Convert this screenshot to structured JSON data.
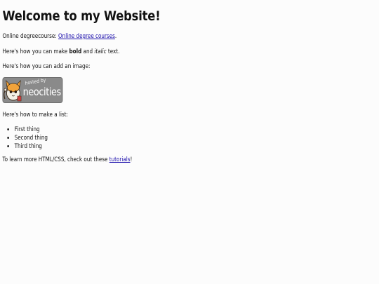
{
  "heading": "Welcome to my Website!",
  "line1": {
    "prefix": "Online degreecourse: ",
    "link_text": "Online degree courses",
    "suffix": "."
  },
  "line2": {
    "prefix": "Here's how you can make ",
    "bold": "bold",
    "middle": " and ",
    "italic": "italic",
    "suffix": " text."
  },
  "line3": "Here's how you can add an image:",
  "badge": {
    "small_text": "hosted by",
    "big_text": "neocities"
  },
  "line4": "Here's how to make a list:",
  "list": [
    "First thing",
    "Second thing",
    "Third thing"
  ],
  "line5": {
    "prefix": "To learn more HTML/CSS, check out these ",
    "link_text": "tutorials",
    "suffix": "!"
  }
}
